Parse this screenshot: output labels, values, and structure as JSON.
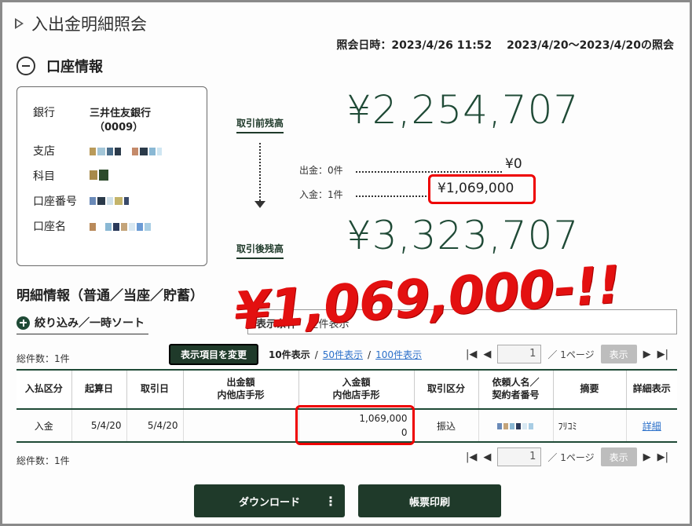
{
  "page": {
    "title": "入出金明細照会",
    "inquiry_datetime": "照会日時：2023/4/26 11:52",
    "inquiry_range": "2023/4/20〜2023/4/20の照会"
  },
  "account_section": {
    "heading": "口座情報",
    "rows": [
      {
        "label": "銀行",
        "value": "三井住友銀行",
        "value2": "（0009）"
      },
      {
        "label": "支店"
      },
      {
        "label": "科目"
      },
      {
        "label": "口座番号"
      },
      {
        "label": "口座名"
      }
    ]
  },
  "balance": {
    "before_label": "取引前残高",
    "before_amount": "¥2,254,707",
    "withdraw_label": "出金：0件",
    "withdraw_amount": "¥0",
    "deposit_label": "入金：1件",
    "deposit_amount": "¥1,069,000",
    "after_label": "取引後残高",
    "after_amount": "¥3,323,707"
  },
  "annotation": {
    "overlay_text": "¥1,069,000-!!"
  },
  "details": {
    "heading": "明細情報（普通／当座／貯蓄）",
    "filter_label": "絞り込み／一時ソート",
    "condition_label": "表示条件",
    "condition_value": "全件表示",
    "total_count_top": "総件数：1件",
    "total_count_bottom": "総件数：1件",
    "change_columns_button": "表示項目を変更",
    "per_page_current": "10件表示",
    "per_page_50": "50件表示",
    "per_page_100": "100件表示",
    "separator": "/",
    "pager": {
      "page_value": "1",
      "page_total": "／ 1ページ",
      "show_button": "表示",
      "first_icon": "|◀",
      "prev_icon": "◀",
      "next_icon": "▶",
      "last_icon": "▶|"
    },
    "columns": [
      "入払区分",
      "起算日",
      "取引日",
      "出金額\n内他店手形",
      "入金額\n内他店手形",
      "取引区分",
      "依頼人名／\n契約者番号",
      "摘要",
      "詳細表示"
    ],
    "rows": [
      {
        "type": "入金",
        "value_date": "5/4/20",
        "trade_date": "5/4/20",
        "withdraw": "",
        "deposit": "1,069,000",
        "deposit_other": "0",
        "category": "振込",
        "requester": "",
        "memo": "ﾌﾘｺﾐ",
        "detail_link": "詳細"
      }
    ]
  },
  "footer": {
    "download_button": "ダウンロード",
    "more_icon": "⋮",
    "print_button": "帳票印刷"
  },
  "colors": {
    "brand_dark": "#1f3a2a",
    "amount_green": "#1f4a36",
    "annotation_red": "#e31010",
    "link_blue": "#2a6fc9"
  }
}
